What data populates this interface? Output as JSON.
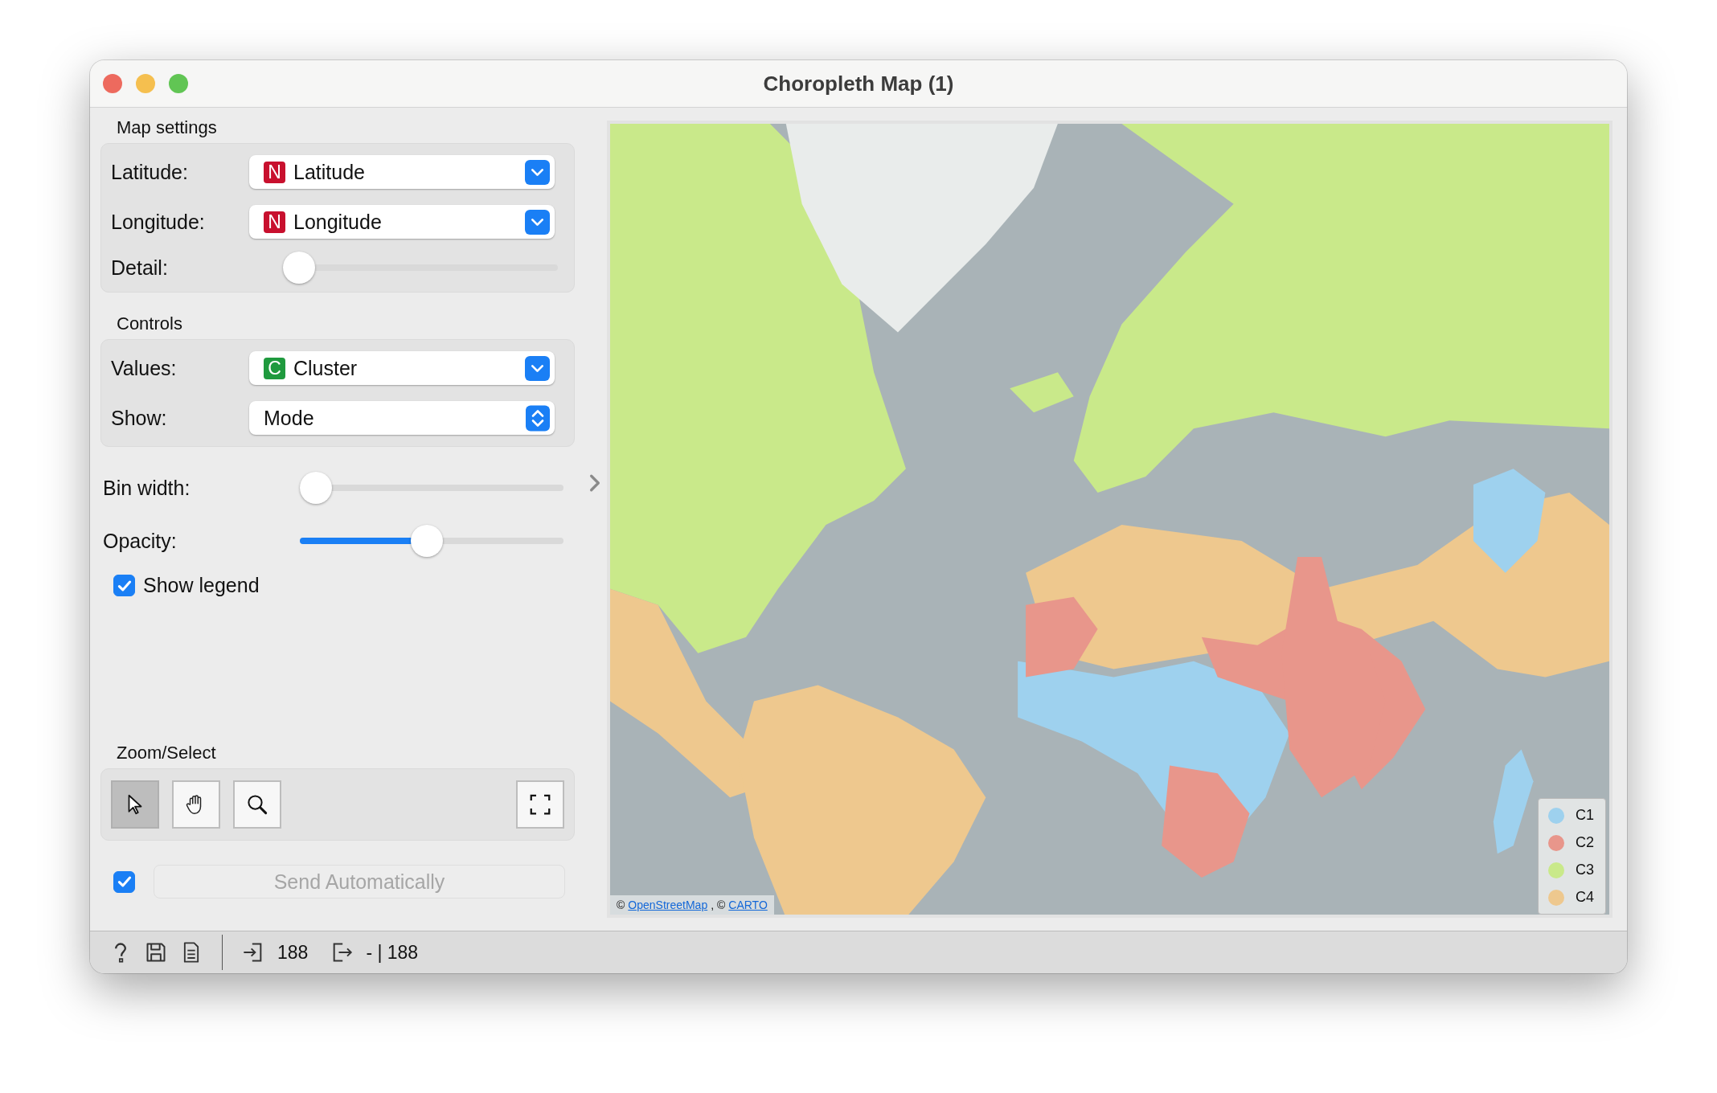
{
  "window": {
    "title": "Choropleth Map (1)"
  },
  "map_settings": {
    "title": "Map settings",
    "latitude": {
      "label": "Latitude:",
      "kind": "numeric",
      "badge": "N",
      "value": "Latitude"
    },
    "longitude": {
      "label": "Longitude:",
      "kind": "numeric",
      "badge": "N",
      "value": "Longitude"
    },
    "detail": {
      "label": "Detail:",
      "level": 0
    }
  },
  "controls": {
    "title": "Controls",
    "values": {
      "label": "Values:",
      "kind": "categorical",
      "badge": "C",
      "value": "Cluster"
    },
    "show": {
      "label": "Show:",
      "value": "Mode"
    }
  },
  "bin_width": {
    "label": "Bin width:",
    "level": 0
  },
  "opacity": {
    "label": "Opacity:",
    "level": 0.48
  },
  "show_legend": {
    "label": "Show legend",
    "checked": true
  },
  "zoom_select": {
    "title": "Zoom/Select",
    "tools": [
      {
        "kind": "pointer",
        "selected": true
      },
      {
        "kind": "pan",
        "selected": false
      },
      {
        "kind": "zoom",
        "selected": false
      }
    ]
  },
  "send": {
    "checked": true,
    "label": "Send Automatically",
    "disabled": true
  },
  "map": {
    "kind": "picture",
    "attribution": [
      {
        "kind": "text",
        "text": "©"
      },
      {
        "kind": "link",
        "text": "OpenStreetMap"
      },
      {
        "kind": "text",
        "text": ", ©"
      },
      {
        "kind": "link",
        "text": "CARTO"
      }
    ],
    "legend": [
      {
        "label": "C1",
        "color": "#9ed1ee"
      },
      {
        "label": "C2",
        "color": "#e8968b"
      },
      {
        "label": "C3",
        "color": "#c9e98a"
      },
      {
        "label": "C4",
        "color": "#eec88e"
      }
    ]
  },
  "status_bar": {
    "input_count": "188",
    "output_count": "- | 188"
  }
}
